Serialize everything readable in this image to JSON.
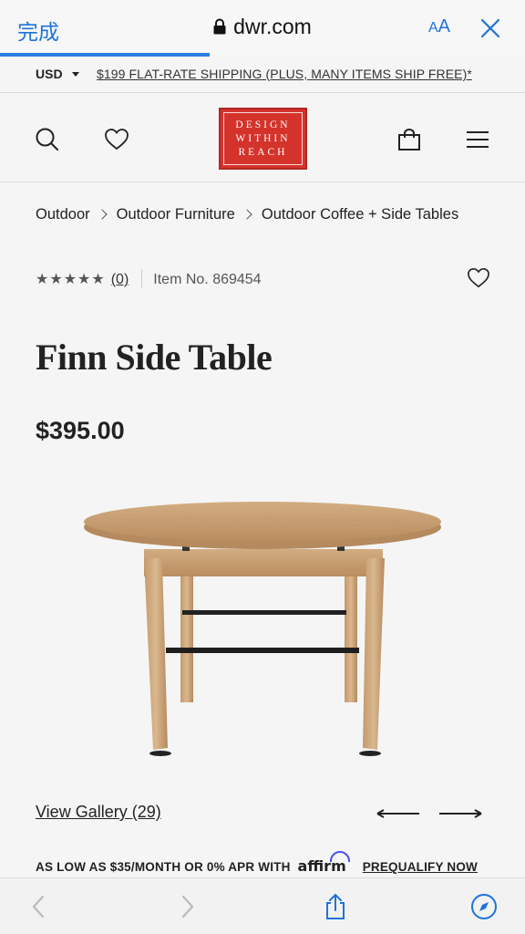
{
  "browser": {
    "done_label": "完成",
    "url": "dwr.com",
    "text_size_label_small": "A",
    "text_size_label_large": "A",
    "load_progress": 0.4
  },
  "promo": {
    "currency": "USD",
    "shipping_text": "$199 FLAT-RATE SHIPPING (PLUS, MANY ITEMS SHIP FREE)*"
  },
  "header": {
    "logo_lines": [
      "DESIGN",
      "WITHIN",
      "REACH"
    ],
    "brand_color": "#d4332c"
  },
  "breadcrumb": [
    "Outdoor",
    "Outdoor Furniture",
    "Outdoor Coffee + Side Tables"
  ],
  "product": {
    "stars": "★★★★★",
    "rating_value": 0,
    "review_count": "(0)",
    "item_number": "Item No. 869454",
    "title": "Finn Side Table",
    "price": "$395.00",
    "image_alt": "Finn Side Table — round teak top on teak frame with black metal stretchers",
    "gallery_link": "View Gallery (29)"
  },
  "financing": {
    "text": "AS LOW AS $35/MONTH OR 0% APR WITH",
    "provider": "affirm",
    "cta": "PREQUALIFY NOW"
  },
  "colors": {
    "accent": "#1f73d9",
    "progress": "#2a7de1",
    "affirm": "#4a4af4"
  }
}
